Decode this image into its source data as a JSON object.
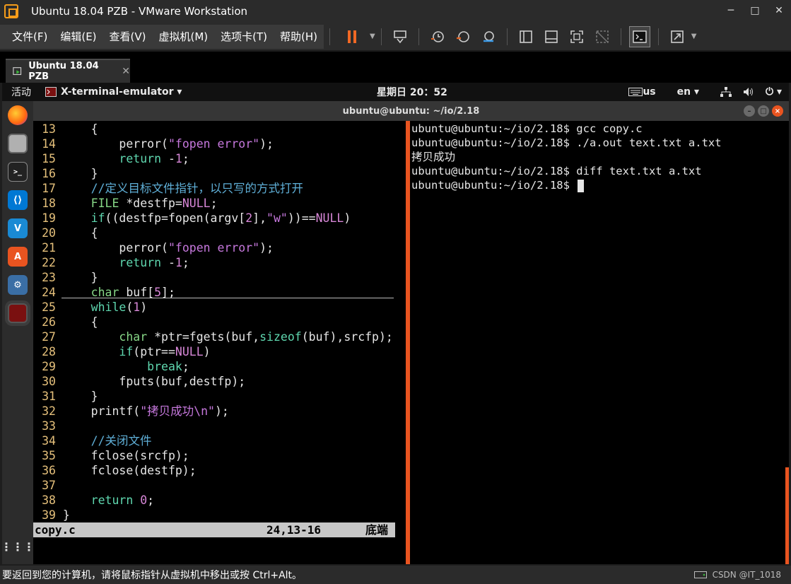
{
  "window": {
    "title": "Ubuntu 18.04 PZB - VMware Workstation",
    "controls": [
      "─",
      "□",
      "✕"
    ]
  },
  "menubar": {
    "items": [
      "文件(F)",
      "编辑(E)",
      "查看(V)",
      "虚拟机(M)",
      "选项卡(T)",
      "帮助(H)"
    ]
  },
  "tab": {
    "label": "Ubuntu 18.04 PZB",
    "close": "✕"
  },
  "ubuntu_topbar": {
    "activities": "活动",
    "app": "X-terminal-emulator ▾",
    "clock": "星期日 20：52",
    "keyboard": "us",
    "lang": "en ▾",
    "power": "⏻ ▾"
  },
  "terminal": {
    "title": "ubuntu@ubuntu: ~/io/2.18"
  },
  "vim": {
    "lines": [
      {
        "n": "13",
        "t": "    {"
      },
      {
        "n": "14",
        "t": "        perror(\"fopen error\");"
      },
      {
        "n": "15",
        "t": "        return -1;"
      },
      {
        "n": "16",
        "t": "    }"
      },
      {
        "n": "17",
        "t": "    //定义目标文件指针，以只写的方式打开"
      },
      {
        "n": "18",
        "t": "    FILE *destfp=NULL;"
      },
      {
        "n": "19",
        "t": "    if((destfp=fopen(argv[2],\"w\"))==NULL)"
      },
      {
        "n": "20",
        "t": "    {"
      },
      {
        "n": "21",
        "t": "        perror(\"fopen error\");"
      },
      {
        "n": "22",
        "t": "        return -1;"
      },
      {
        "n": "23",
        "t": "    }"
      },
      {
        "n": "24",
        "t": "    char buf[5];"
      },
      {
        "n": "25",
        "t": "    while(1)"
      },
      {
        "n": "26",
        "t": "    {"
      },
      {
        "n": "27",
        "t": "        char *ptr=fgets(buf,sizeof(buf),srcfp);"
      },
      {
        "n": "28",
        "t": "        if(ptr==NULL)"
      },
      {
        "n": "29",
        "t": "            break;"
      },
      {
        "n": "30",
        "t": "        fputs(buf,destfp);"
      },
      {
        "n": "31",
        "t": "    }"
      },
      {
        "n": "32",
        "t": "    printf(\"拷贝成功\\n\");"
      },
      {
        "n": "33",
        "t": ""
      },
      {
        "n": "34",
        "t": "    //关闭文件"
      },
      {
        "n": "35",
        "t": "    fclose(srcfp);"
      },
      {
        "n": "36",
        "t": "    fclose(destfp);"
      },
      {
        "n": "37",
        "t": ""
      },
      {
        "n": "38",
        "t": "    return 0;"
      },
      {
        "n": "39",
        "t": "}"
      }
    ],
    "status": {
      "file": "copy.c",
      "position": "24,13-16",
      "percent": "底端"
    }
  },
  "shell": {
    "lines": [
      "ubuntu@ubuntu:~/io/2.18$ gcc copy.c",
      "ubuntu@ubuntu:~/io/2.18$ ./a.out text.txt a.txt",
      "拷贝成功",
      "ubuntu@ubuntu:~/io/2.18$ diff text.txt a.txt",
      "ubuntu@ubuntu:~/io/2.18$ "
    ]
  },
  "statusbar": {
    "message": "要返回到您的计算机，请将鼠标指针从虚拟机中移出或按 Ctrl+Alt。",
    "watermark": "CSDN @IT_1018"
  }
}
